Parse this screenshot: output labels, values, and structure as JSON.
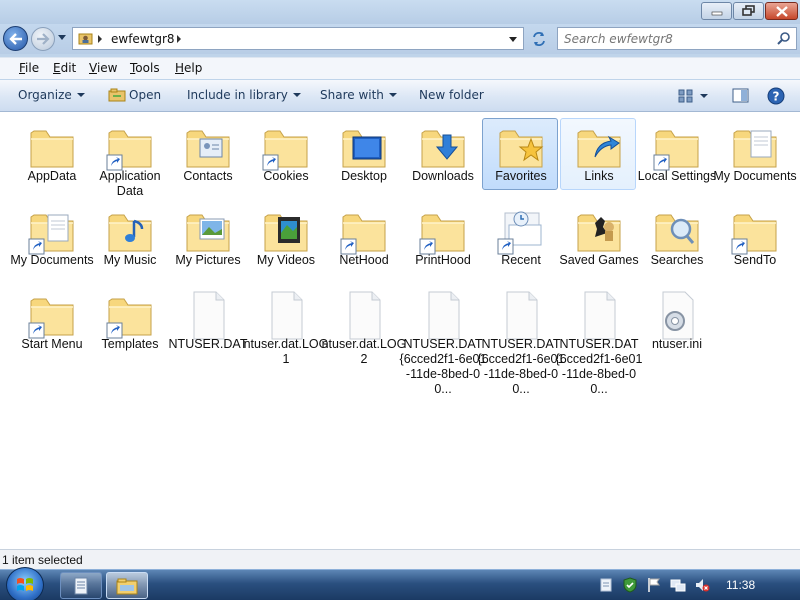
{
  "address": {
    "breadcrumb": "ewfewtgr8",
    "search_placeholder": "Search ewfewtgr8"
  },
  "menu": [
    "File",
    "Edit",
    "View",
    "Tools",
    "Help"
  ],
  "commands": {
    "organize": "Organize",
    "open": "Open",
    "include": "Include in library",
    "share": "Share with",
    "new_folder": "New folder"
  },
  "items": [
    {
      "label": "AppData",
      "icon": "folder-icon",
      "shortcut": false,
      "selected": false
    },
    {
      "label": "Application Data",
      "icon": "folder-icon",
      "shortcut": true,
      "selected": false
    },
    {
      "label": "Contacts",
      "icon": "contacts-folder-icon",
      "shortcut": false,
      "selected": false
    },
    {
      "label": "Cookies",
      "icon": "folder-icon",
      "shortcut": true,
      "selected": false
    },
    {
      "label": "Desktop",
      "icon": "desktop-folder-icon",
      "shortcut": false,
      "selected": false
    },
    {
      "label": "Downloads",
      "icon": "downloads-folder-icon",
      "shortcut": false,
      "selected": false
    },
    {
      "label": "Favorites",
      "icon": "favorites-folder-icon",
      "shortcut": false,
      "selected": true
    },
    {
      "label": "Links",
      "icon": "links-folder-icon",
      "shortcut": false,
      "selected": false
    },
    {
      "label": "Local Settings",
      "icon": "folder-icon",
      "shortcut": true,
      "selected": false
    },
    {
      "label": "My Documents",
      "icon": "documents-folder-icon",
      "shortcut": false,
      "selected": false
    },
    {
      "label": "My Documents",
      "icon": "documents-folder-icon",
      "shortcut": true,
      "selected": false
    },
    {
      "label": "My Music",
      "icon": "music-folder-icon",
      "shortcut": false,
      "selected": false
    },
    {
      "label": "My Pictures",
      "icon": "pictures-folder-icon",
      "shortcut": false,
      "selected": false
    },
    {
      "label": "My Videos",
      "icon": "videos-folder-icon",
      "shortcut": false,
      "selected": false
    },
    {
      "label": "NetHood",
      "icon": "folder-icon",
      "shortcut": true,
      "selected": false
    },
    {
      "label": "PrintHood",
      "icon": "folder-icon",
      "shortcut": true,
      "selected": false
    },
    {
      "label": "Recent",
      "icon": "recent-icon",
      "shortcut": true,
      "selected": false
    },
    {
      "label": "Saved Games",
      "icon": "saved-games-folder-icon",
      "shortcut": false,
      "selected": false
    },
    {
      "label": "Searches",
      "icon": "searches-folder-icon",
      "shortcut": false,
      "selected": false
    },
    {
      "label": "SendTo",
      "icon": "folder-icon",
      "shortcut": true,
      "selected": false
    },
    {
      "label": "Start Menu",
      "icon": "folder-icon",
      "shortcut": true,
      "selected": false
    },
    {
      "label": "Templates",
      "icon": "folder-icon",
      "shortcut": true,
      "selected": false
    },
    {
      "label": "NTUSER.DAT",
      "icon": "file-icon",
      "shortcut": false,
      "selected": false
    },
    {
      "label": "ntuser.dat.LOG1",
      "icon": "file-icon",
      "shortcut": false,
      "selected": false
    },
    {
      "label": "ntuser.dat.LOG2",
      "icon": "file-icon",
      "shortcut": false,
      "selected": false
    },
    {
      "label": "NTUSER.DAT{6cced2f1-6e01-11de-8bed-00...",
      "icon": "file-icon",
      "shortcut": false,
      "selected": false
    },
    {
      "label": "NTUSER.DAT{6cced2f1-6e01-11de-8bed-00...",
      "icon": "file-icon",
      "shortcut": false,
      "selected": false
    },
    {
      "label": "NTUSER.DAT{6cced2f1-6e01-11de-8bed-00...",
      "icon": "file-icon",
      "shortcut": false,
      "selected": false
    },
    {
      "label": "ntuser.ini",
      "icon": "settings-file-icon",
      "shortcut": false,
      "selected": false
    }
  ],
  "status": "1 item selected",
  "clock": "11:38",
  "colors": {
    "selection": "#c1dcfc",
    "folder": "#f5d67b",
    "taskbar": "#2a4f7f"
  }
}
